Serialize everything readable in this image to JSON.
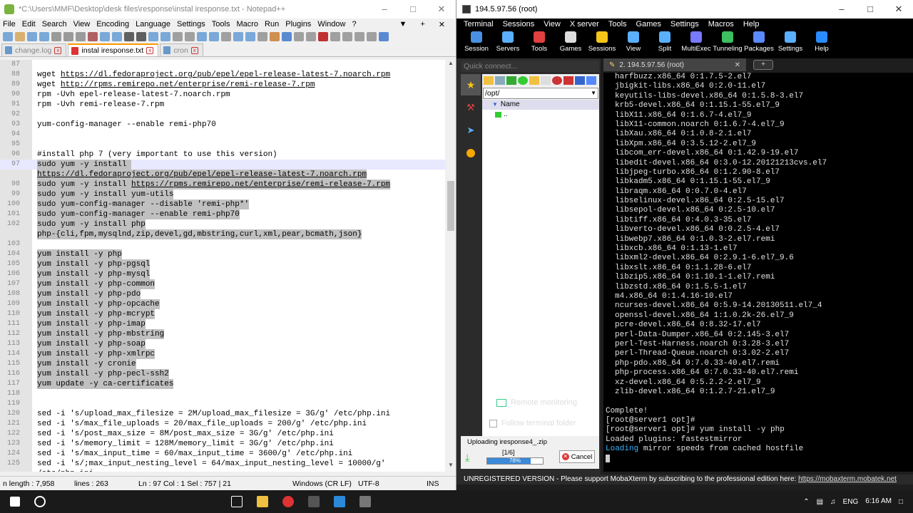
{
  "npp": {
    "title": "*C:\\Users\\MMF\\Desktop\\desk files\\response\\instal iresponse.txt - Notepad++",
    "menu": [
      "File",
      "Edit",
      "Search",
      "View",
      "Encoding",
      "Language",
      "Settings",
      "Tools",
      "Macro",
      "Run",
      "Plugins",
      "Window",
      "?"
    ],
    "tabs": [
      {
        "label": "change.log",
        "active": false
      },
      {
        "label": "instal iresponse.txt",
        "active": true
      },
      {
        "label": "cron",
        "active": false
      }
    ],
    "lines": [
      {
        "n": "87",
        "t": "",
        "sel": false
      },
      {
        "n": "88",
        "t": "wget ",
        "url": "https://dl.fedoraproject.org/pub/epel/epel-release-latest-7.noarch.rpm",
        "sel": false
      },
      {
        "n": "89",
        "t": "wget ",
        "url": "http://rpms.remirepo.net/enterprise/remi-release-7.rpm",
        "sel": false
      },
      {
        "n": "90",
        "t": "rpm -Uvh epel-release-latest-7.noarch.rpm",
        "sel": false
      },
      {
        "n": "91",
        "t": "rpm -Uvh remi-release-7.rpm",
        "sel": false
      },
      {
        "n": "92",
        "t": "",
        "sel": false
      },
      {
        "n": "93",
        "t": "yum-config-manager --enable remi-php70",
        "sel": false
      },
      {
        "n": "94",
        "t": "",
        "sel": false
      },
      {
        "n": "95",
        "t": "",
        "sel": false
      },
      {
        "n": "96",
        "t": "#install php 7 (very important to use this version)",
        "sel": false
      },
      {
        "n": "97",
        "t": "sudo yum -y install ",
        "sel": true,
        "cur": true
      },
      {
        "n": "",
        "t": "",
        "url": "https://dl.fedoraproject.org/pub/epel/epel-release-latest-7.noarch.rpm",
        "sel": true
      },
      {
        "n": "98",
        "t": "sudo yum -y install ",
        "url": "https://rpms.remirepo.net/enterprise/remi-release-7.rpm",
        "sel": true
      },
      {
        "n": "99",
        "t": "sudo yum -y install yum-utils",
        "sel": true
      },
      {
        "n": "100",
        "t": "sudo yum-config-manager --disable 'remi-php*'",
        "sel": true
      },
      {
        "n": "101",
        "t": "sudo yum-config-manager --enable remi-php70",
        "sel": true
      },
      {
        "n": "102",
        "t": "sudo yum -y install php",
        "sel": true
      },
      {
        "n": "",
        "t": "php-{cli,fpm,mysqlnd,zip,devel,gd,mbstring,curl,xml,pear,bcmath,json}",
        "sel": true
      },
      {
        "n": "103",
        "t": "",
        "sel": true
      },
      {
        "n": "104",
        "t": "yum install -y php",
        "sel": true
      },
      {
        "n": "105",
        "t": "yum install -y php-pgsql",
        "sel": true
      },
      {
        "n": "106",
        "t": "yum install -y php-mysql",
        "sel": true
      },
      {
        "n": "107",
        "t": "yum install -y php-common",
        "sel": true
      },
      {
        "n": "108",
        "t": "yum install -y php-pdo",
        "sel": true
      },
      {
        "n": "109",
        "t": "yum install -y php-opcache",
        "sel": true
      },
      {
        "n": "110",
        "t": "yum install -y php-mcrypt",
        "sel": true
      },
      {
        "n": "111",
        "t": "yum install -y php-imap",
        "sel": true
      },
      {
        "n": "112",
        "t": "yum install -y php-mbstring",
        "sel": true
      },
      {
        "n": "113",
        "t": "yum install -y php-soap",
        "sel": true
      },
      {
        "n": "114",
        "t": "yum install -y php-xmlrpc",
        "sel": true
      },
      {
        "n": "115",
        "t": "yum install -y cronie",
        "sel": true
      },
      {
        "n": "116",
        "t": "yum install -y php-pecl-ssh2",
        "sel": true
      },
      {
        "n": "117",
        "t": "yum update -y ca-certificates",
        "sel": true
      },
      {
        "n": "118",
        "t": "",
        "sel": false
      },
      {
        "n": "119",
        "t": "",
        "sel": false
      },
      {
        "n": "120",
        "t": "sed -i 's/upload_max_filesize = 2M/upload_max_filesize = 3G/g' /etc/php.ini",
        "sel": false
      },
      {
        "n": "121",
        "t": "sed -i 's/max_file_uploads = 20/max_file_uploads = 200/g' /etc/php.ini",
        "sel": false
      },
      {
        "n": "122",
        "t": "sed -i 's/post_max_size = 8M/post_max_size = 3G/g' /etc/php.ini",
        "sel": false
      },
      {
        "n": "123",
        "t": "sed -i 's/memory_limit = 128M/memory_limit = 3G/g' /etc/php.ini",
        "sel": false
      },
      {
        "n": "124",
        "t": "sed -i 's/max_input_time = 60/max_input_time = 3600/g' /etc/php.ini",
        "sel": false
      },
      {
        "n": "125",
        "t": "sed -i 's/;max_input_nesting_level = 64/max_input_nesting_level = 10000/g'",
        "sel": false
      },
      {
        "n": "",
        "t": "/etc/php.ini",
        "sel": false
      }
    ],
    "status": {
      "length": "n length : 7,958",
      "lines": "lines : 263",
      "pos": "Ln : 97    Col : 1    Sel : 757 | 21",
      "eol": "Windows (CR LF)",
      "enc": "UTF-8",
      "mode": "INS"
    }
  },
  "moba": {
    "title": "194.5.97.56 (root)",
    "menu": [
      "Terminal",
      "Sessions",
      "View",
      "X server",
      "Tools",
      "Games",
      "Settings",
      "Macros",
      "Help"
    ],
    "tools": [
      {
        "label": "Session",
        "icon": "session-icon",
        "color": "#4a90e2"
      },
      {
        "label": "Servers",
        "icon": "servers-icon",
        "color": "#5ab0ff"
      },
      {
        "label": "Tools",
        "icon": "tools-icon",
        "color": "#e04040"
      },
      {
        "label": "Games",
        "icon": "gamepad-icon",
        "color": "#dddddd"
      },
      {
        "label": "Sessions",
        "icon": "star-icon",
        "color": "#f5c518"
      },
      {
        "label": "View",
        "icon": "view-icon",
        "color": "#5ab0ff"
      },
      {
        "label": "Split",
        "icon": "split-icon",
        "color": "#5ab0ff"
      },
      {
        "label": "MultiExec",
        "icon": "multiexec-icon",
        "color": "#7a7aff"
      },
      {
        "label": "Tunneling",
        "icon": "tunneling-icon",
        "color": "#3cc060"
      },
      {
        "label": "Packages",
        "icon": "packages-icon",
        "color": "#5a8aff"
      },
      {
        "label": "Settings",
        "icon": "gear-icon",
        "color": "#5ab0ff"
      },
      {
        "label": "Help",
        "icon": "help-icon",
        "color": "#2a8aff"
      }
    ],
    "quick_connect": "Quick connect...",
    "sftp_path": "/opt/",
    "sftp_header": "Name",
    "sftp_item": "..",
    "remote_monitoring": "Remote monitoring",
    "follow_folder": "Follow terminal folder",
    "upload": {
      "label": "Uploading iresponse4_.zip",
      "count": "[1/6]",
      "percent": "78%",
      "progress": 0.78,
      "cancel": "Cancel"
    },
    "terminal_tab": "2. 194.5.97.56 (root)",
    "terminal_lines": [
      "harfbuzz.x86_64 0:1.7.5-2.el7",
      "jbigkit-libs.x86_64 0:2.0-11.el7",
      "keyutils-libs-devel.x86_64 0:1.5.8-3.el7",
      "krb5-devel.x86_64 0:1.15.1-55.el7_9",
      "libX11.x86_64 0:1.6.7-4.el7_9",
      "libX11-common.noarch 0:1.6.7-4.el7_9",
      "libXau.x86_64 0:1.0.8-2.1.el7",
      "libXpm.x86_64 0:3.5.12-2.el7_9",
      "libcom_err-devel.x86_64 0:1.42.9-19.el7",
      "libedit-devel.x86_64 0:3.0-12.20121213cvs.el7",
      "libjpeg-turbo.x86_64 0:1.2.90-8.el7",
      "libkadm5.x86_64 0:1.15.1-55.el7_9",
      "libraqm.x86_64 0:0.7.0-4.el7",
      "libselinux-devel.x86_64 0:2.5-15.el7",
      "libsepol-devel.x86_64 0:2.5-10.el7",
      "libtiff.x86_64 0:4.0.3-35.el7",
      "libverto-devel.x86_64 0:0.2.5-4.el7",
      "libwebp7.x86_64 0:1.0.3-2.el7.remi",
      "libxcb.x86_64 0:1.13-1.el7",
      "libxml2-devel.x86_64 0:2.9.1-6.el7_9.6",
      "libxslt.x86_64 0:1.1.28-6.el7",
      "libzip5.x86_64 0:1.10.1-1.el7.remi",
      "libzstd.x86_64 0:1.5.5-1.el7",
      "m4.x86_64 0:1.4.16-10.el7",
      "ncurses-devel.x86_64 0:5.9-14.20130511.el7_4",
      "openssl-devel.x86_64 1:1.0.2k-26.el7_9",
      "pcre-devel.x86_64 0:8.32-17.el7",
      "perl-Data-Dumper.x86_64 0:2.145-3.el7",
      "perl-Test-Harness.noarch 0:3.28-3.el7",
      "perl-Thread-Queue.noarch 0:3.02-2.el7",
      "php-pdo.x86_64 0:7.0.33-40.el7.remi",
      "php-process.x86_64 0:7.0.33-40.el7.remi",
      "xz-devel.x86_64 0:5.2.2-2.el7_9",
      "zlib-devel.x86_64 0:1.2.7-21.el7_9"
    ],
    "terminal_tail": {
      "blank": "",
      "complete": "Complete!",
      "prompt1": "[root@server1 opt]#",
      "prompt2": "[root@server1 opt]# yum install -y php",
      "plugins": "Loaded plugins: fastestmirror",
      "loading": "Loading",
      "loading_rest": " mirror speeds from cached hostfile"
    },
    "status_text": "UNREGISTERED VERSION  -  Please support MobaXterm by subscribing to the professional edition here: ",
    "status_link": "https://mobaxterm.mobatek.net"
  },
  "taskbar": {
    "lang": "ENG",
    "time": "6:16 AM"
  }
}
